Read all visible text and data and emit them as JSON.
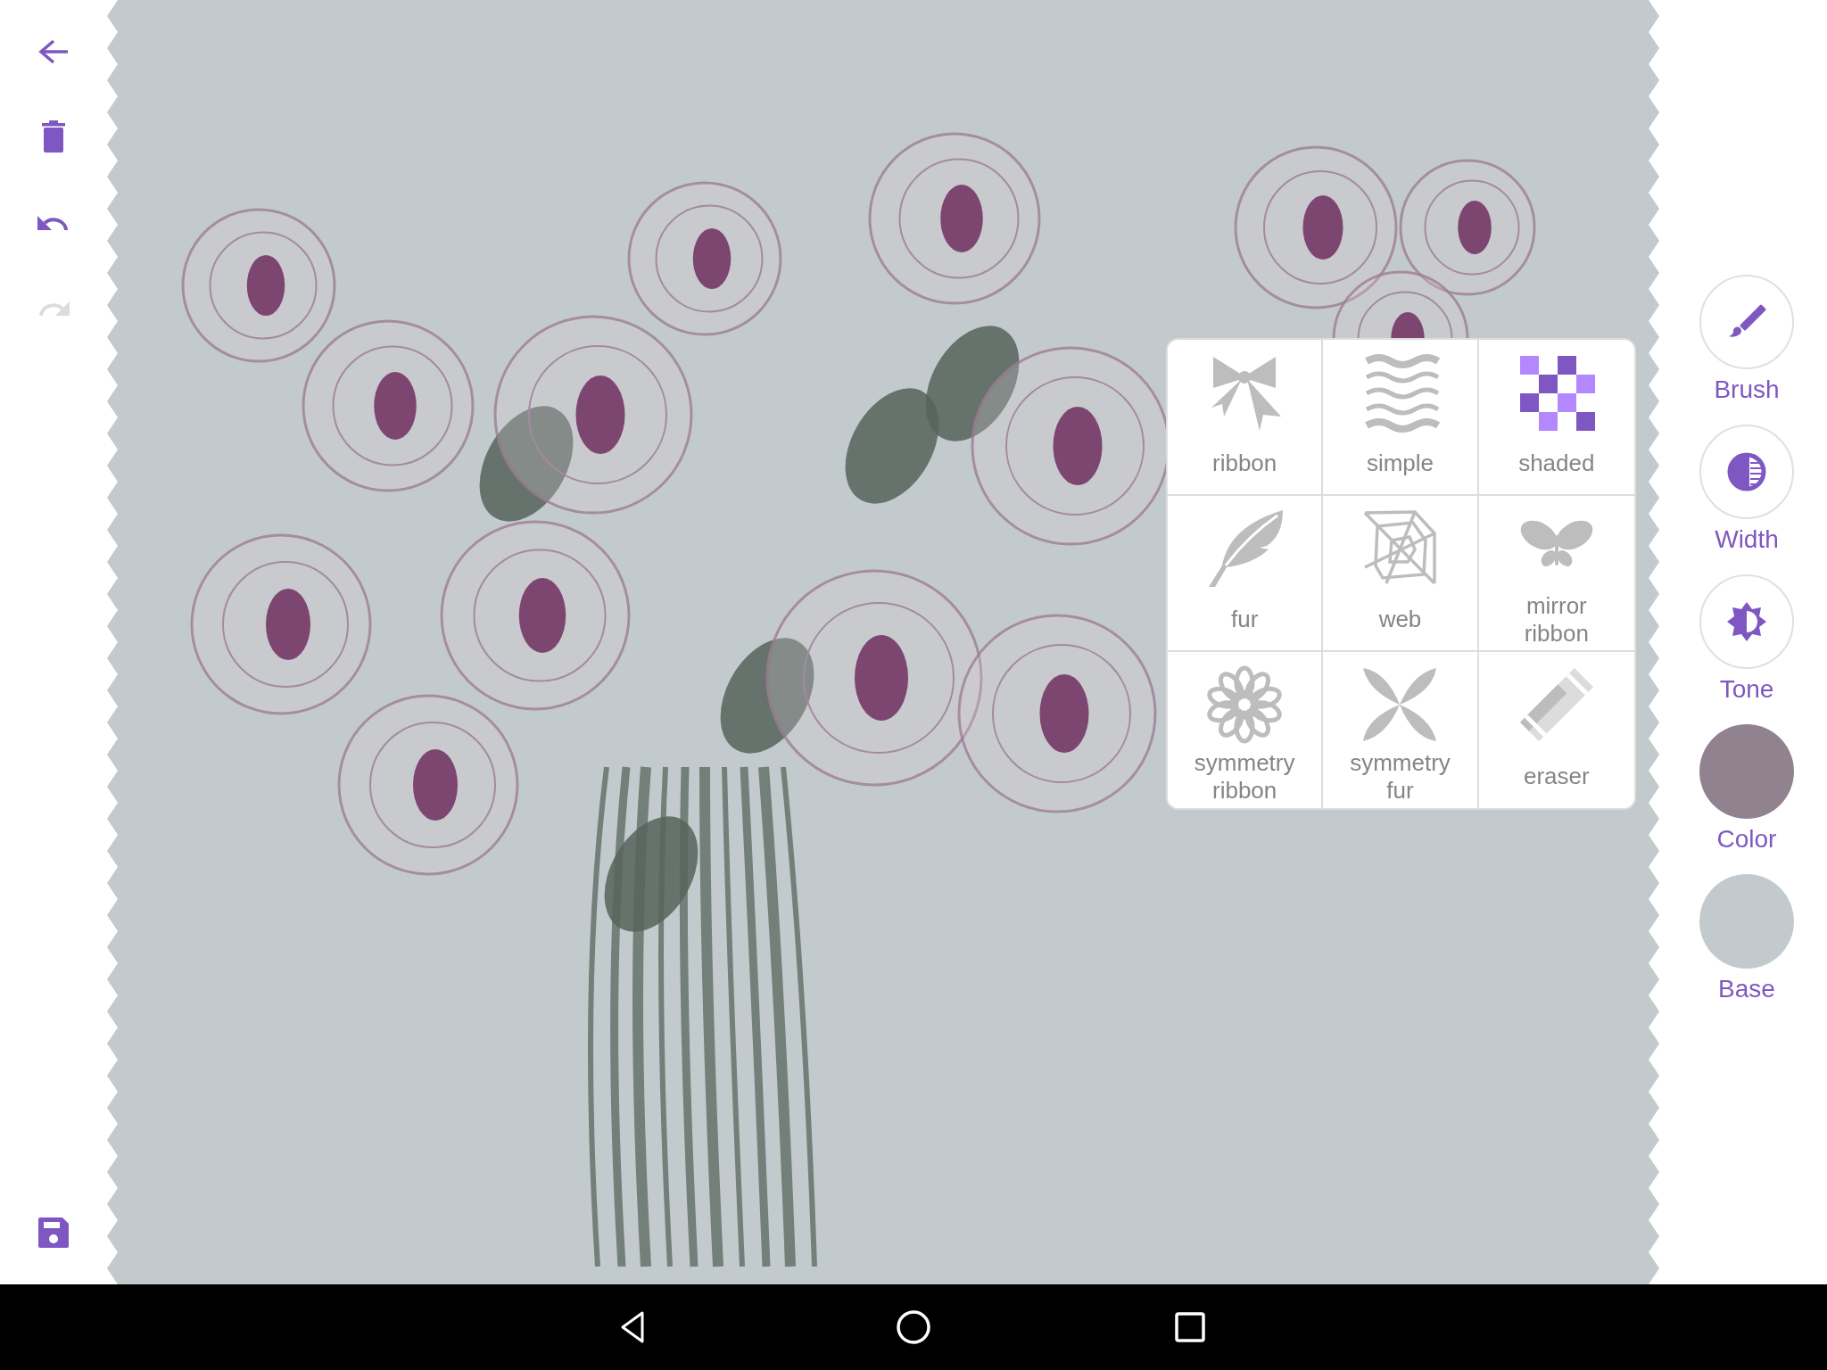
{
  "left_toolbar": [
    {
      "kind": "back",
      "disabled": false
    },
    {
      "kind": "delete",
      "disabled": false
    },
    {
      "kind": "undo",
      "disabled": false
    },
    {
      "kind": "redo",
      "disabled": true
    },
    {
      "kind": "save",
      "disabled": false
    }
  ],
  "brush_menu": [
    {
      "label": "ribbon",
      "kind": "ribbon",
      "selected": false
    },
    {
      "label": "simple",
      "kind": "simple",
      "selected": false
    },
    {
      "label": "shaded",
      "kind": "shaded",
      "selected": true
    },
    {
      "label": "fur",
      "kind": "fur",
      "selected": false
    },
    {
      "label": "web",
      "kind": "web",
      "selected": false
    },
    {
      "label": "mirror ribbon",
      "kind": "mirror",
      "selected": false
    },
    {
      "label": "symmetry ribbon",
      "kind": "flower",
      "selected": false
    },
    {
      "label": "symmetry fur",
      "kind": "leaves",
      "selected": false
    },
    {
      "label": "eraser",
      "kind": "eraser",
      "selected": false
    }
  ],
  "right_toolbar": [
    {
      "label": "Brush",
      "kind": "brush"
    },
    {
      "label": "Width",
      "kind": "width"
    },
    {
      "label": "Tone",
      "kind": "tone"
    },
    {
      "label": "Color",
      "kind": "swatch",
      "color": "#918290"
    },
    {
      "label": "Base",
      "kind": "swatch",
      "color": "#c3cacd"
    }
  ],
  "nav_bar": [
    {
      "kind": "back"
    },
    {
      "kind": "home"
    },
    {
      "kind": "recents"
    }
  ]
}
